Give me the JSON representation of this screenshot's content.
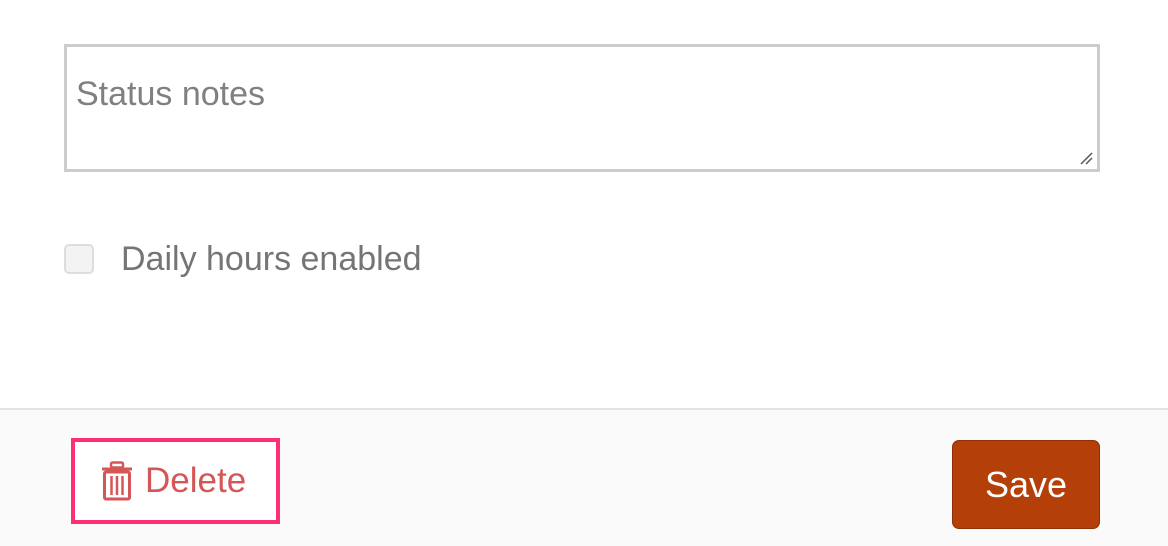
{
  "form": {
    "status_notes": {
      "value": "",
      "placeholder": "Status notes"
    },
    "daily_hours": {
      "label": "Daily hours enabled",
      "checked": false
    }
  },
  "footer": {
    "delete_label": "Delete",
    "save_label": "Save",
    "delete_icon": "trash-icon"
  },
  "colors": {
    "delete_text": "#d55656",
    "delete_highlight_border": "#ff2e78",
    "save_background": "#b53f08",
    "save_text": "#ffffff"
  }
}
